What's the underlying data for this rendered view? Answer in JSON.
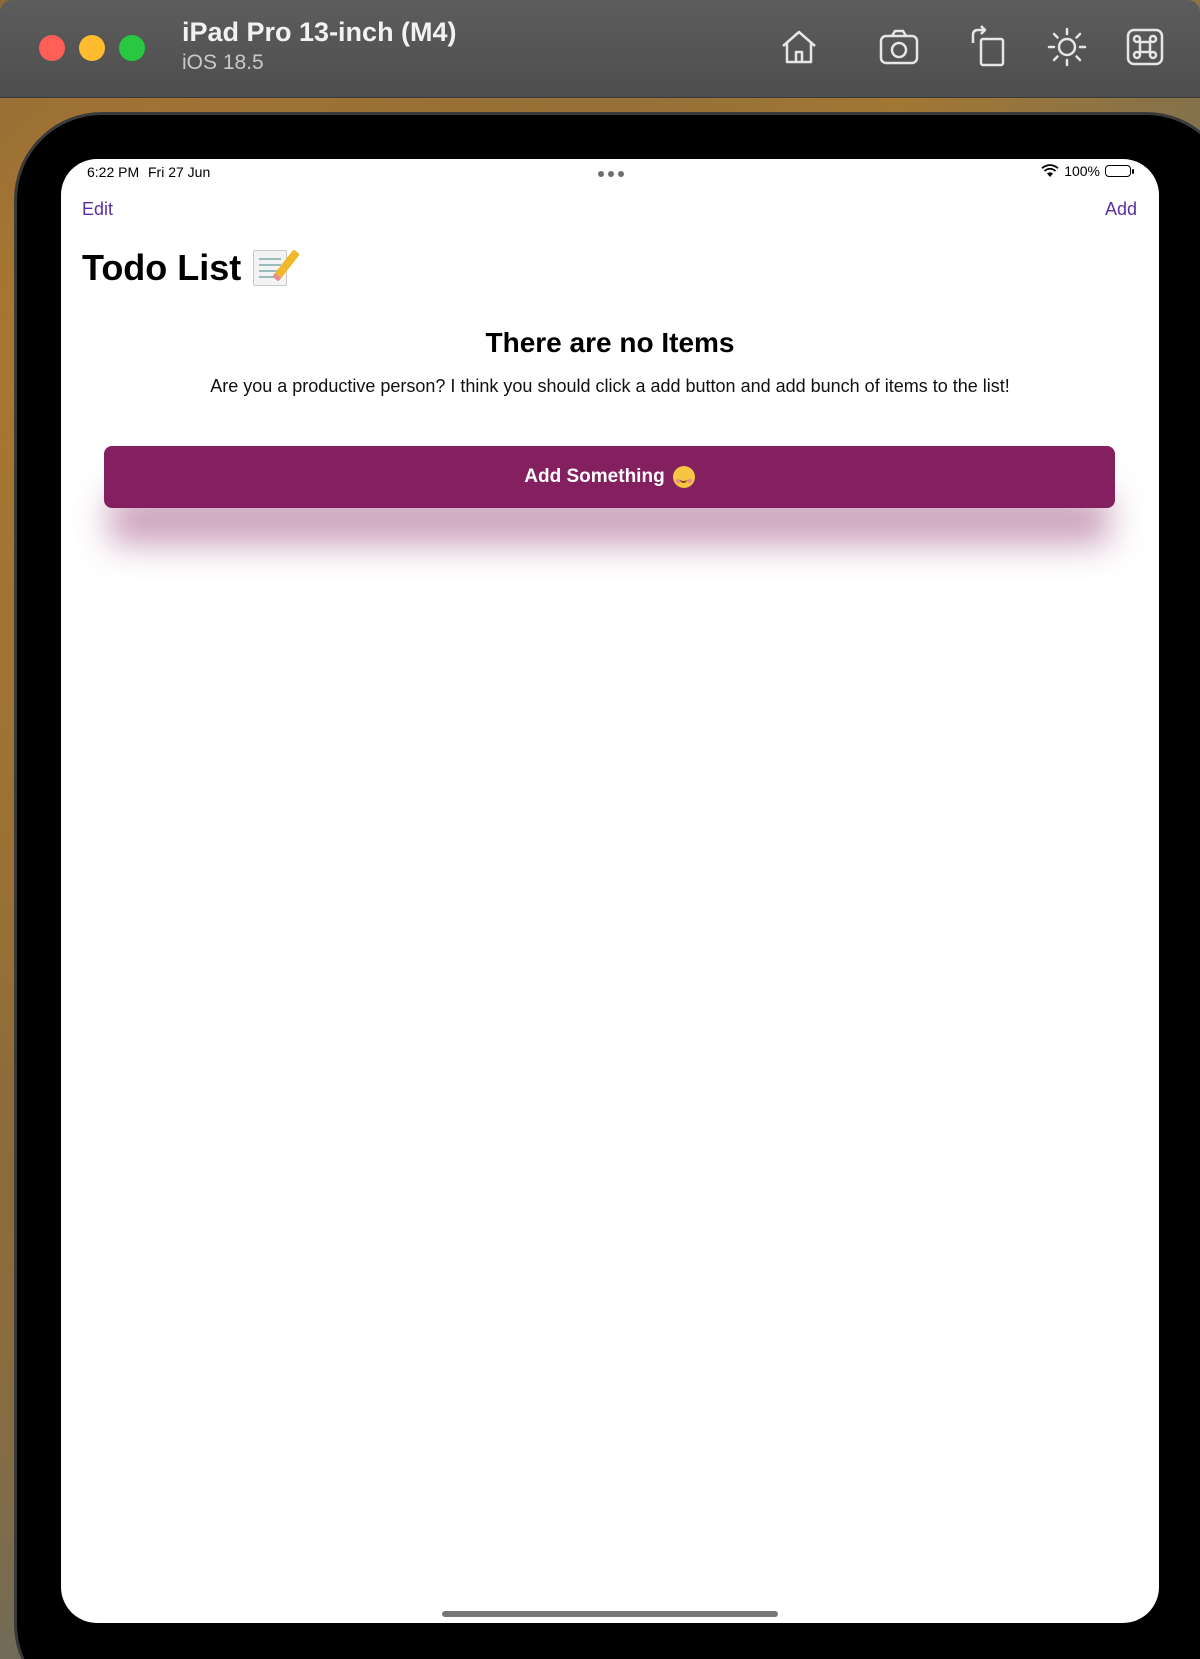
{
  "simulator": {
    "device_name": "iPad Pro 13-inch (M4)",
    "os_version": "iOS 18.5",
    "toolbar_icons": [
      "home-icon",
      "screenshot-icon",
      "rotate-icon",
      "brightness-icon",
      "command-icon"
    ]
  },
  "status_bar": {
    "time": "6:22 PM",
    "date": "Fri 27 Jun",
    "battery": "100%"
  },
  "nav": {
    "edit_label": "Edit",
    "add_label": "Add"
  },
  "page": {
    "title": "Todo List",
    "title_icon": "memo-icon"
  },
  "empty_state": {
    "title": "There are no Items",
    "message": "Are you a productive person? I think you should click a add button and add bunch of items to the list!",
    "button_label": "Add Something",
    "button_icon": "partying-face-icon"
  },
  "colors": {
    "accent": "#5a2f9e",
    "button": "#84205f"
  }
}
